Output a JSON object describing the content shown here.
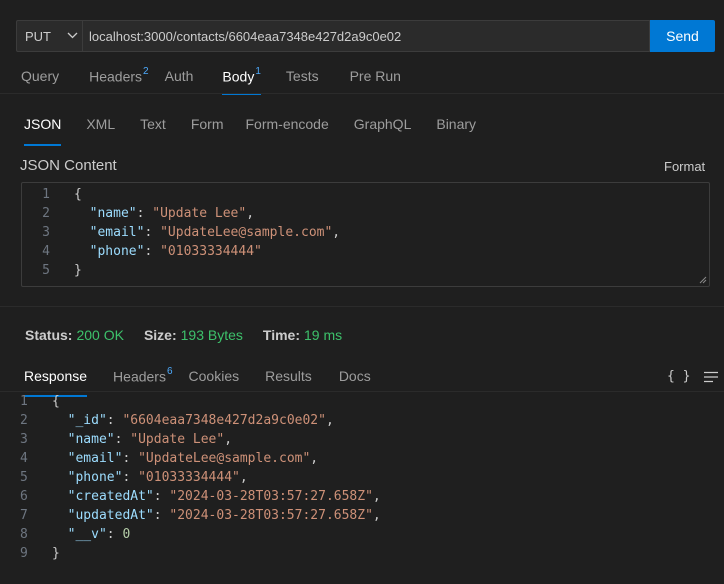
{
  "request": {
    "method": "PUT",
    "url": "localhost:3000/contacts/6604eaa7348e427d2a9c0e02",
    "send_label": "Send"
  },
  "request_tabs": [
    {
      "label": "Query",
      "badge": ""
    },
    {
      "label": "Headers",
      "badge": "2"
    },
    {
      "label": "Auth",
      "badge": ""
    },
    {
      "label": "Body",
      "badge": "1"
    },
    {
      "label": "Tests",
      "badge": ""
    },
    {
      "label": "Pre Run",
      "badge": ""
    }
  ],
  "body_types": [
    "JSON",
    "XML",
    "Text",
    "Form",
    "Form-encode",
    "GraphQL",
    "Binary"
  ],
  "json_content_label": "JSON Content",
  "format_label": "Format",
  "request_body_lines": [
    {
      "n": "1",
      "indent": "",
      "key": "",
      "value": "",
      "text": "{"
    },
    {
      "n": "2",
      "indent": "  ",
      "key": "\"name\"",
      "value": "\"Update Lee\"",
      "text": ","
    },
    {
      "n": "3",
      "indent": "  ",
      "key": "\"email\"",
      "value": "\"UpdateLee@sample.com\"",
      "text": ","
    },
    {
      "n": "4",
      "indent": "  ",
      "key": "\"phone\"",
      "value": "\"01033334444\"",
      "text": ""
    },
    {
      "n": "5",
      "indent": "",
      "key": "",
      "value": "",
      "text": "}"
    }
  ],
  "status": {
    "status_label": "Status:",
    "status_value": "200 OK",
    "size_label": "Size:",
    "size_value": "193 Bytes",
    "time_label": "Time:",
    "time_value": "19 ms"
  },
  "response_tabs": [
    {
      "label": "Response",
      "badge": ""
    },
    {
      "label": "Headers",
      "badge": "6"
    },
    {
      "label": "Cookies",
      "badge": ""
    },
    {
      "label": "Results",
      "badge": ""
    },
    {
      "label": "Docs",
      "badge": ""
    }
  ],
  "braces_label": "{ }",
  "response_lines": [
    {
      "n": "1",
      "indent": "",
      "key": "",
      "value": "",
      "vtype": "",
      "text": "{"
    },
    {
      "n": "2",
      "indent": "  ",
      "key": "\"_id\"",
      "value": "\"6604eaa7348e427d2a9c0e02\"",
      "vtype": "str",
      "text": ","
    },
    {
      "n": "3",
      "indent": "  ",
      "key": "\"name\"",
      "value": "\"Update Lee\"",
      "vtype": "str",
      "text": ","
    },
    {
      "n": "4",
      "indent": "  ",
      "key": "\"email\"",
      "value": "\"UpdateLee@sample.com\"",
      "vtype": "str",
      "text": ","
    },
    {
      "n": "5",
      "indent": "  ",
      "key": "\"phone\"",
      "value": "\"01033334444\"",
      "vtype": "str",
      "text": ","
    },
    {
      "n": "6",
      "indent": "  ",
      "key": "\"createdAt\"",
      "value": "\"2024-03-28T03:57:27.658Z\"",
      "vtype": "str",
      "text": ","
    },
    {
      "n": "7",
      "indent": "  ",
      "key": "\"updatedAt\"",
      "value": "\"2024-03-28T03:57:27.658Z\"",
      "vtype": "str",
      "text": ","
    },
    {
      "n": "8",
      "indent": "  ",
      "key": "\"__v\"",
      "value": "0",
      "vtype": "num",
      "text": ""
    },
    {
      "n": "9",
      "indent": "",
      "key": "",
      "value": "",
      "vtype": "",
      "text": "}"
    }
  ],
  "colors": {
    "accent": "#0078d4",
    "status_ok": "#3dc16b",
    "badge": "#4daafc"
  }
}
